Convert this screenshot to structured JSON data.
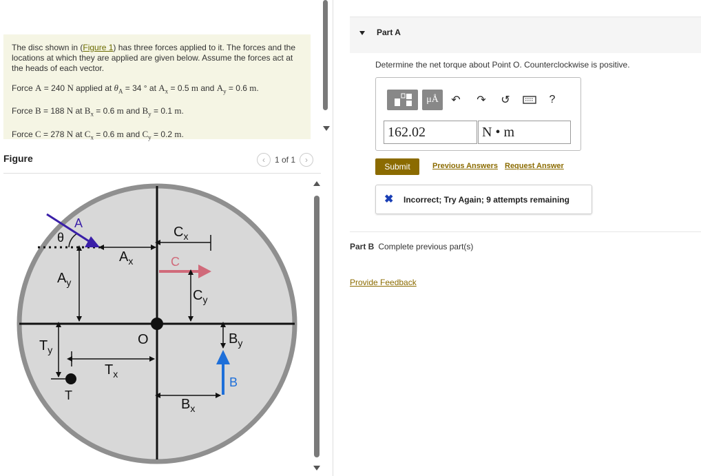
{
  "problem": {
    "intro_pre": "The disc shown in (",
    "figure_link": "Figure 1",
    "intro_post": ") has three forces applied to it. The forces and the locations at which they are applied are given below. Assume the forces act at the heads of each vector.",
    "force_a": {
      "p1": "Force ",
      "v1": "A",
      "p2": " = 240 ",
      "v2": "N",
      "p3": " applied at ",
      "v3": "θ",
      "s3": "A",
      "p4": " = 34 ° at ",
      "v4": "A",
      "s4": "x",
      "p5": " = 0.5 ",
      "v5": "m",
      "p6": " and ",
      "v6": "A",
      "s6": "y",
      "p7": " = 0.6 ",
      "v7": "m",
      "p8": "."
    },
    "force_b": {
      "p1": "Force ",
      "v1": "B",
      "p2": " = 188 ",
      "v2": "N",
      "p3": " at ",
      "v3": "B",
      "s3": "x",
      "p4": " = 0.6 ",
      "v4": "m",
      "p5": " and ",
      "v5": "B",
      "s5": "y",
      "p6": " = 0.1 ",
      "v6": "m",
      "p7": "."
    },
    "force_c": {
      "p1": "Force ",
      "v1": "C",
      "p2": " = 278 ",
      "v2": "N",
      "p3": " at ",
      "v3": "C",
      "s3": "x",
      "p4": " = 0.6 ",
      "v4": "m",
      "p5": " and ",
      "v5": "C",
      "s5": "y",
      "p6": " = 0.2 ",
      "v6": "m",
      "p7": "."
    }
  },
  "figure": {
    "title": "Figure",
    "pager": "1 of 1",
    "labels": {
      "A": "A",
      "theta": "θ",
      "Ax": "A",
      "Ax_sub": "x",
      "Ay": "A",
      "Ay_sub": "y",
      "C": "C",
      "Cx": "C",
      "Cx_sub": "x",
      "Cy": "C",
      "Cy_sub": "y",
      "O": "O",
      "Ty": "T",
      "Ty_sub": "y",
      "Tx": "T",
      "Tx_sub": "x",
      "T": "T",
      "By": "B",
      "By_sub": "y",
      "B": "B",
      "Bx": "B",
      "Bx_sub": "x"
    },
    "colors": {
      "force_a": "#3a1fa8",
      "force_b": "#1e6fd9",
      "force_c": "#d06a7a",
      "disc": "#d8d8d8",
      "rim": "#8f8f8f"
    }
  },
  "part_a": {
    "label": "Part A",
    "question": "Determine the net torque about Point O. Counterclockwise is positive.",
    "toolbar": {
      "template_icon": "template-icon",
      "units_label": "μÅ",
      "undo_icon": "undo-icon",
      "redo_icon": "redo-icon",
      "reset_icon": "reset-icon",
      "keyboard_icon": "keyboard-icon",
      "help_label": "?"
    },
    "answer_value": "162.02",
    "answer_unit": "N • m",
    "submit_label": "Submit",
    "previous_answers": "Previous Answers",
    "request_answer": "Request Answer",
    "feedback": "Incorrect; Try Again; 9 attempts remaining"
  },
  "part_b": {
    "label": "Part B",
    "text": "Complete previous part(s)"
  },
  "provide_feedback": "Provide Feedback"
}
